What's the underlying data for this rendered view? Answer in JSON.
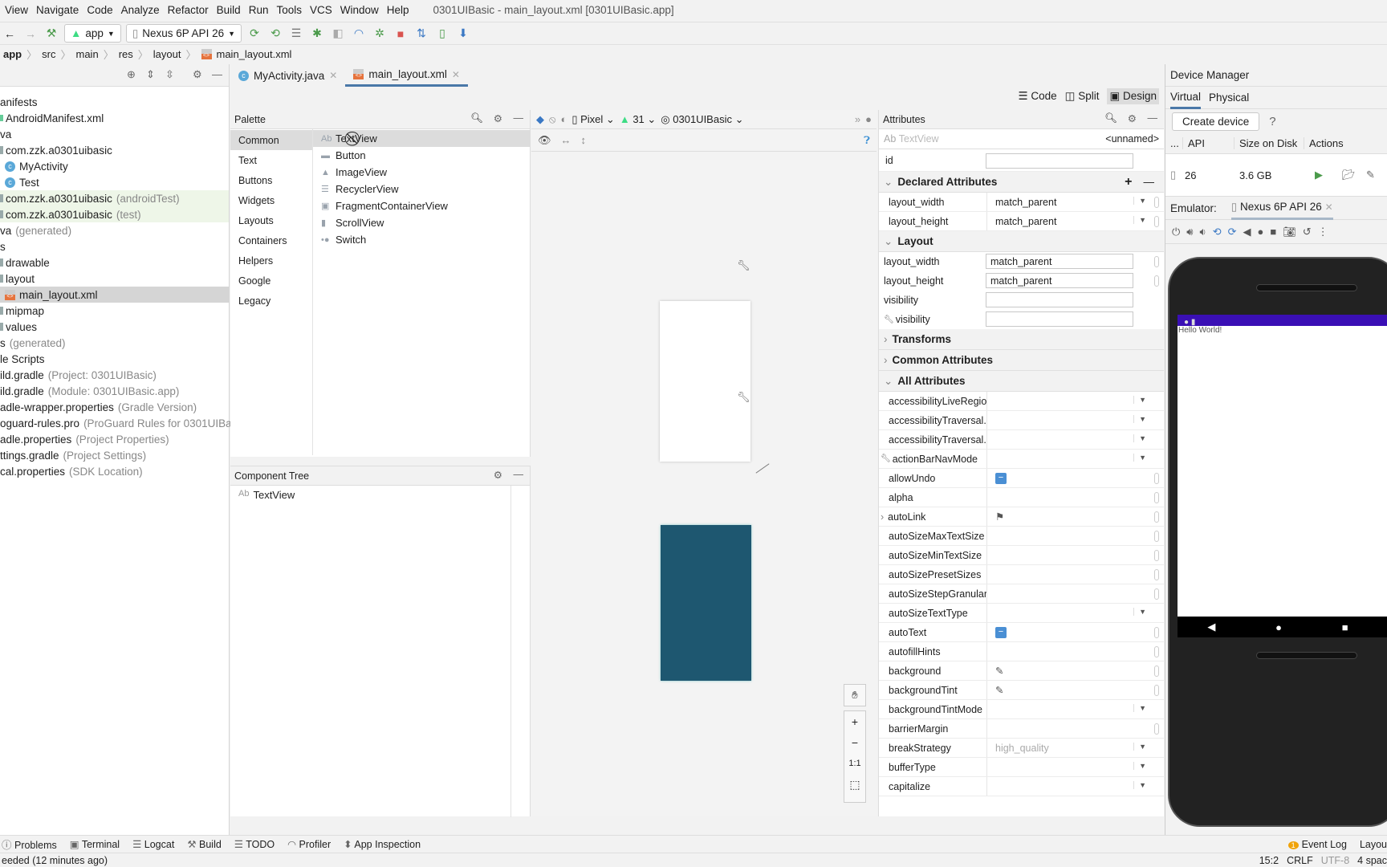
{
  "menu": [
    "View",
    "Navigate",
    "Code",
    "Analyze",
    "Refactor",
    "Build",
    "Run",
    "Tools",
    "VCS",
    "Window",
    "Help"
  ],
  "window_title": "0301UIBasic - main_layout.xml [0301UIBasic.app]",
  "toolbar": {
    "run_config": "app",
    "device": "Nexus 6P API 26"
  },
  "breadcrumb": [
    "app",
    "src",
    "main",
    "res",
    "layout",
    "main_layout.xml"
  ],
  "tabs": [
    {
      "label": "MyActivity.java"
    },
    {
      "label": "main_layout.xml",
      "active": true
    }
  ],
  "project_tree": [
    {
      "label": "anifests",
      "dim": ""
    },
    {
      "label": "AndroidManifest.xml",
      "dim": "",
      "icon": "manifest"
    },
    {
      "label": "va",
      "dim": ""
    },
    {
      "label": "com.zzk.a0301uibasic",
      "dim": "",
      "icon": "folder"
    },
    {
      "label": "MyActivity",
      "dim": "",
      "icon": "class"
    },
    {
      "label": "Test",
      "dim": "",
      "icon": "class"
    },
    {
      "label": "com.zzk.a0301uibasic",
      "dim": "(androidTest)",
      "icon": "folder",
      "green": true
    },
    {
      "label": "com.zzk.a0301uibasic",
      "dim": "(test)",
      "icon": "folder",
      "green": true
    },
    {
      "label": "va",
      "dim": "(generated)"
    },
    {
      "label": "s",
      "dim": ""
    },
    {
      "label": "drawable",
      "dim": "",
      "icon": "folder"
    },
    {
      "label": "layout",
      "dim": "",
      "icon": "folder"
    },
    {
      "label": "main_layout.xml",
      "dim": "",
      "icon": "xml",
      "selected": true
    },
    {
      "label": "mipmap",
      "dim": "",
      "icon": "folder"
    },
    {
      "label": "values",
      "dim": "",
      "icon": "folder"
    },
    {
      "label": "s",
      "dim": "(generated)"
    },
    {
      "label": "le Scripts",
      "dim": ""
    },
    {
      "label": "ild.gradle",
      "dim": "(Project: 0301UIBasic)"
    },
    {
      "label": "ild.gradle",
      "dim": "(Module: 0301UIBasic.app)"
    },
    {
      "label": "adle-wrapper.properties",
      "dim": "(Gradle Version)"
    },
    {
      "label": "oguard-rules.pro",
      "dim": "(ProGuard Rules for 0301UIBas"
    },
    {
      "label": "adle.properties",
      "dim": "(Project Properties)"
    },
    {
      "label": "ttings.gradle",
      "dim": "(Project Settings)"
    },
    {
      "label": "cal.properties",
      "dim": "(SDK Location)"
    }
  ],
  "view_modes": [
    "Code",
    "Split",
    "Design"
  ],
  "palette": {
    "title": "Palette",
    "categories": [
      "Common",
      "Text",
      "Buttons",
      "Widgets",
      "Layouts",
      "Containers",
      "Helpers",
      "Google",
      "Legacy"
    ],
    "items": [
      "TextView",
      "Button",
      "ImageView",
      "RecyclerView",
      "FragmentContainerView",
      "ScrollView",
      "Switch"
    ]
  },
  "component_tree": {
    "title": "Component Tree",
    "items": [
      "TextView"
    ]
  },
  "canvas_toolbar": {
    "device": "Pixel",
    "api": "31",
    "theme": "0301UIBasic"
  },
  "canvas": {
    "blueprint_color": "#1e5770",
    "zoom_buttons": [
      "+",
      "−",
      "1:1"
    ]
  },
  "attributes": {
    "title": "Attributes",
    "widget": "TextView",
    "name": "<unnamed>",
    "id_label": "id",
    "declared_title": "Declared Attributes",
    "declared": [
      {
        "name": "layout_width",
        "value": "match_parent"
      },
      {
        "name": "layout_height",
        "value": "match_parent"
      }
    ],
    "layout_title": "Layout",
    "layout": [
      {
        "name": "layout_width",
        "value": "match_parent"
      },
      {
        "name": "layout_height",
        "value": "match_parent"
      },
      {
        "name": "visibility",
        "value": ""
      },
      {
        "name": "visibility",
        "value": "",
        "tool": true
      }
    ],
    "collapsed": [
      "Transforms",
      "Common Attributes"
    ],
    "all_title": "All Attributes",
    "all": [
      {
        "name": "accessibilityLiveRegion",
        "kind": "dd"
      },
      {
        "name": "accessibilityTraversal...",
        "kind": "dd"
      },
      {
        "name": "accessibilityTraversal...",
        "kind": "dd"
      },
      {
        "name": "actionBarNavMode",
        "kind": "dd",
        "tool": true
      },
      {
        "name": "allowUndo",
        "kind": "toggle"
      },
      {
        "name": "alpha",
        "kind": ""
      },
      {
        "name": "autoLink",
        "kind": "flag"
      },
      {
        "name": "autoSizeMaxTextSize",
        "kind": ""
      },
      {
        "name": "autoSizeMinTextSize",
        "kind": ""
      },
      {
        "name": "autoSizePresetSizes",
        "kind": ""
      },
      {
        "name": "autoSizeStepGranular...",
        "kind": ""
      },
      {
        "name": "autoSizeTextType",
        "kind": "dd"
      },
      {
        "name": "autoText",
        "kind": "toggle"
      },
      {
        "name": "autofillHints",
        "kind": ""
      },
      {
        "name": "background",
        "kind": "picker"
      },
      {
        "name": "backgroundTint",
        "kind": "picker"
      },
      {
        "name": "backgroundTintMode",
        "kind": "dd"
      },
      {
        "name": "barrierMargin",
        "kind": ""
      },
      {
        "name": "breakStrategy",
        "kind": "dd",
        "value": "high_quality"
      },
      {
        "name": "bufferType",
        "kind": "dd"
      },
      {
        "name": "capitalize",
        "kind": "dd"
      }
    ]
  },
  "device_manager": {
    "title": "Device Manager",
    "tabs": [
      "Virtual",
      "Physical"
    ],
    "create": "Create device",
    "help": "?",
    "columns": [
      "...",
      "API",
      "Size on Disk",
      "Actions"
    ],
    "devices": [
      {
        "api": "26",
        "size": "3.6 GB"
      }
    ],
    "emulator_label": "Emulator:",
    "emulator_tab": "Nexus 6P API 26",
    "screen_text": "Hello World!",
    "status_color": "#3a0fb5"
  },
  "bottom_tools": [
    "Problems",
    "Terminal",
    "Logcat",
    "Build",
    "TODO",
    "Profiler",
    "App Inspection"
  ],
  "bottom_right": [
    "Event Log",
    "Layou"
  ],
  "status": {
    "message": "eeded (12 minutes ago)",
    "position": "15:2",
    "line_sep": "CRLF",
    "encoding": "UTF-8",
    "indent": "4 spac"
  }
}
